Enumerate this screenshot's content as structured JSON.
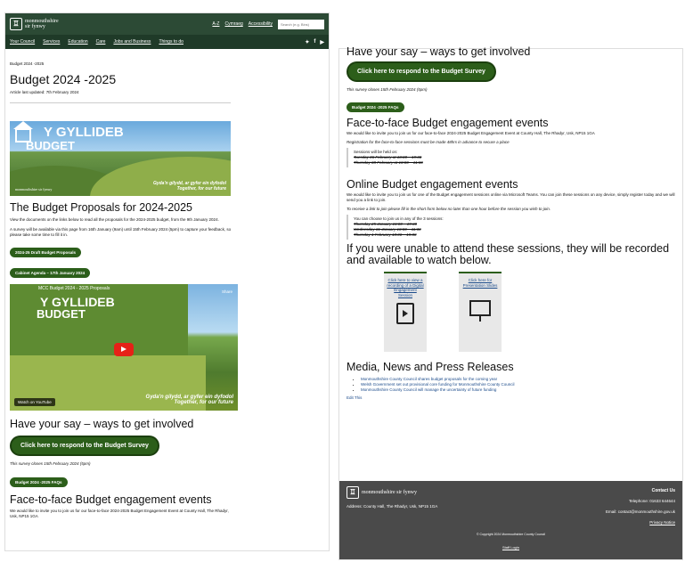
{
  "header": {
    "logo_name": "monmouthshire",
    "logo_name2": "sir fynwy",
    "top_links": [
      "A-Z",
      "Cymraeg",
      "Accessibility"
    ],
    "search_placeholder": "Search (e.g. Bins)",
    "nav": [
      "Your Council",
      "Services",
      "Education",
      "Care",
      "Jobs and Business",
      "Things to do"
    ],
    "social": [
      "t",
      "f",
      "yt"
    ]
  },
  "left": {
    "breadcrumb": "Budget 2024 -2025",
    "page_title": "Budget 2024 -2025",
    "updated": "Article last updated: 7th February 2024",
    "banner_title_1": "Y GYLLIDEB",
    "banner_title_2": "BUDGET",
    "banner_tag_1": "Gyda'n gilydd, ar gyfer ein dyfodol",
    "banner_tag_2": "Together, for our future",
    "banner_logo": "monmouthshire sir fynwy",
    "proposals_heading": "The Budget Proposals for 2024-2025",
    "proposals_p1": "View the documents on the links below to read all the proposals for the 2024-2025 budget, from the 9th January 2024.",
    "proposals_p2": "A survey will be available via this page from 16th January (9am) until 15th February 2024 (5pm) to capture your feedback, so please take some time to fill it in.",
    "btn_draft": "2024-25 Draft Budget Proposals",
    "btn_cabinet": "Cabinet Agenda – 17th January 2024",
    "video_title": "MCC Budget 2024 - 2025 Proposals",
    "video_share": "Share",
    "video_watch": "Watch on YouTube",
    "video_big_1": "Y GYLLIDEB",
    "video_big_2": "BUDGET",
    "video_tag_1": "Gyda'n gilydd, ar gyfer ein dyfodol",
    "video_tag_2": "Together, for our future",
    "say_heading": "Have your say – ways to get involved",
    "btn_survey": "Click here to respond to the Budget Survey",
    "survey_closes": "This survey closes 15th February 2024 (5pm)",
    "btn_faq": "Budget 2024 -2025 FAQs",
    "f2f_heading": "Face-to-face Budget engagement events",
    "f2f_p": "We would like to invite you to join us for our face-to-face 2024-2025 Budget Engagement Event at County Hall, The Rhadyr, Usk, NP15 1GA"
  },
  "right": {
    "say_heading": "Have your say – ways to get involved",
    "btn_survey": "Click here to respond to the Budget Survey",
    "survey_closes": "This survey closes 15th February 2024 (5pm)",
    "btn_faq": "Budget 2024 -2025 FAQs",
    "f2f_heading": "Face-to-face Budget engagement events",
    "f2f_p": "We would like to invite you to join us for our face-to-face 2024-2025 Budget Engagement Event at County Hall, The Rhadyr, Usk, NP15 1GA",
    "f2f_note": "Registration for the face-to-face sessions must be made 48hrs in advance to secure a place",
    "f2f_sessions_label": "Sessions will be held on:",
    "f2f_session_1": "Tuesday 06 February at 18:00 – 19:30",
    "f2f_session_2": "Thursday 08 February at 10:00 – 11:30",
    "online_heading": "Online Budget engagement events",
    "online_p": "We would like to invite you to join us for one of the Budget engagement sessions online via Microsoft Teams. You can join these sessions on any device, simply register today and we will send you a link to join.",
    "online_note": "To receive a link to join please fill in the short form below no later than one hour before the session you wish to join.",
    "online_sessions_label": "You can choose to join us in any of the 3 sessions:",
    "online_session_1": "Thursday 25 January 18:00 – 19:30",
    "online_session_2": "Wednesday 31 January 10:00 – 11:30",
    "online_session_3": "Thursday 1 February 18:00 – 19:30",
    "recorded_heading": "If you were unable to attend these sessions, they will be recorded and available to watch below.",
    "card_1": "Click here to view a recording of a Digital Engagement Session",
    "card_2": "Click here for Presentation Slides",
    "media_heading": "Media, News and Press Releases",
    "news": [
      "Monmouthshire County Council shares budget proposals for the coming year",
      "Welsh Government set out provisional core funding for Monmouthshire County Council",
      "Monmouthshire County Council will manage the uncertainty of future funding"
    ],
    "edit_link": "Edit This",
    "footer_logo": "monmouthshire sir fynwy",
    "footer_address": "Address: County Hall, The Rhadyr, Usk, NP15 1GA",
    "footer_contact": "Contact Us",
    "footer_phone": "Telephone: 01633 644644",
    "footer_email": "Email: contact@monmouthshire.gov.uk",
    "footer_privacy": "Privacy Notice",
    "footer_copyright": "© Copyright 2024 Monmouthshire County Council",
    "footer_login": "Staff Login"
  },
  "colors": {
    "header_green": "#2c4a35",
    "button_green": "#2c5e1a",
    "footer_grey": "#4a4a4a"
  }
}
